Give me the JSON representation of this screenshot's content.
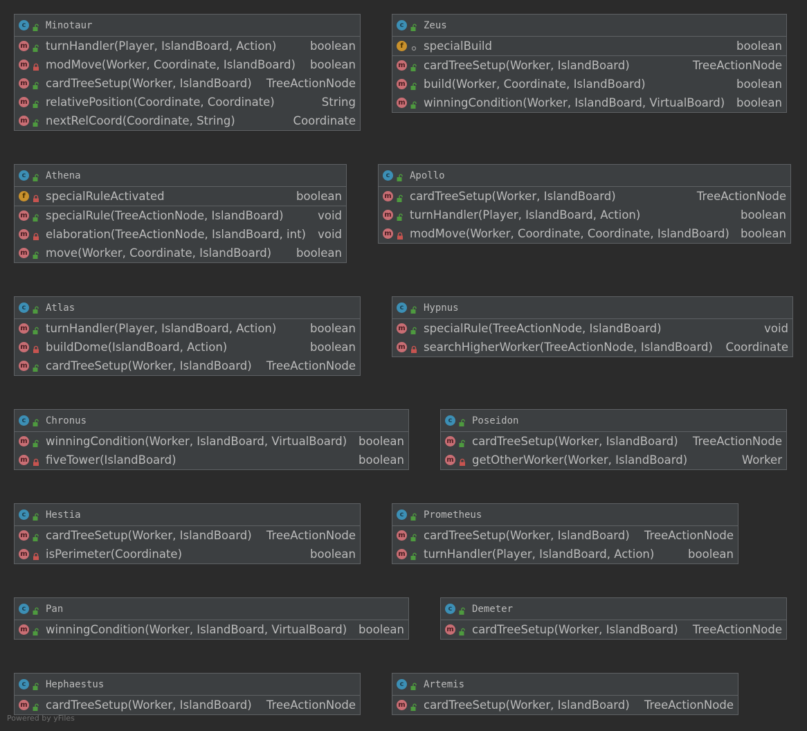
{
  "classes": [
    {
      "name": "Minotaur",
      "badge": "c",
      "rows": [
        {
          "kind": "m",
          "vis": "public",
          "sig": "turnHandler(Player, IslandBoard, Action)",
          "type": "boolean"
        },
        {
          "kind": "m",
          "vis": "private",
          "sig": "modMove(Worker, Coordinate, IslandBoard)",
          "type": "boolean"
        },
        {
          "kind": "m",
          "vis": "public",
          "sig": "cardTreeSetup(Worker, IslandBoard)",
          "type": "TreeActionNode"
        },
        {
          "kind": "m",
          "vis": "public",
          "sig": "relativePosition(Coordinate, Coordinate)",
          "type": "String"
        },
        {
          "kind": "m",
          "vis": "public",
          "sig": "nextRelCoord(Coordinate, String)",
          "type": "Coordinate"
        }
      ]
    },
    {
      "name": "Zeus",
      "badge": "c",
      "rows": [
        {
          "kind": "f",
          "vis": "package",
          "sig": "specialBuild",
          "type": "boolean"
        },
        {
          "kind": "m",
          "vis": "public",
          "sig": "cardTreeSetup(Worker, IslandBoard)",
          "type": "TreeActionNode",
          "sep": true
        },
        {
          "kind": "m",
          "vis": "public",
          "sig": "build(Worker, Coordinate, IslandBoard)",
          "type": "boolean"
        },
        {
          "kind": "m",
          "vis": "public",
          "sig": "winningCondition(Worker, IslandBoard, VirtualBoard)",
          "type": "boolean"
        }
      ]
    },
    {
      "name": "Athena",
      "badge": "c",
      "rows": [
        {
          "kind": "f",
          "vis": "private",
          "sig": "specialRuleActivated",
          "type": "boolean"
        },
        {
          "kind": "m",
          "vis": "public",
          "sig": "specialRule(TreeActionNode, IslandBoard)",
          "type": "void",
          "sep": true
        },
        {
          "kind": "m",
          "vis": "private",
          "sig": "elaboration(TreeActionNode, IslandBoard, int)",
          "type": "void"
        },
        {
          "kind": "m",
          "vis": "public",
          "sig": "move(Worker, Coordinate, IslandBoard)",
          "type": "boolean"
        }
      ]
    },
    {
      "name": "Apollo",
      "badge": "c",
      "rows": [
        {
          "kind": "m",
          "vis": "public",
          "sig": "cardTreeSetup(Worker, IslandBoard)",
          "type": "TreeActionNode"
        },
        {
          "kind": "m",
          "vis": "public",
          "sig": "turnHandler(Player, IslandBoard, Action)",
          "type": "boolean"
        },
        {
          "kind": "m",
          "vis": "private",
          "sig": "modMove(Worker, Coordinate, Coordinate, IslandBoard)",
          "type": "boolean"
        }
      ]
    },
    {
      "name": "Atlas",
      "badge": "c",
      "rows": [
        {
          "kind": "m",
          "vis": "public",
          "sig": "turnHandler(Player, IslandBoard, Action)",
          "type": "boolean"
        },
        {
          "kind": "m",
          "vis": "private",
          "sig": "buildDome(IslandBoard, Action)",
          "type": "boolean"
        },
        {
          "kind": "m",
          "vis": "public",
          "sig": "cardTreeSetup(Worker, IslandBoard)",
          "type": "TreeActionNode"
        }
      ]
    },
    {
      "name": "Hypnus",
      "badge": "c",
      "rows": [
        {
          "kind": "m",
          "vis": "public",
          "sig": "specialRule(TreeActionNode, IslandBoard)",
          "type": "void"
        },
        {
          "kind": "m",
          "vis": "private",
          "sig": "searchHigherWorker(TreeActionNode, IslandBoard)",
          "type": "Coordinate"
        }
      ]
    },
    {
      "name": "Chronus",
      "badge": "c",
      "rows": [
        {
          "kind": "m",
          "vis": "public",
          "sig": "winningCondition(Worker, IslandBoard, VirtualBoard)",
          "type": "boolean"
        },
        {
          "kind": "m",
          "vis": "private",
          "sig": "fiveTower(IslandBoard)",
          "type": "boolean"
        }
      ]
    },
    {
      "name": "Poseidon",
      "badge": "c",
      "rows": [
        {
          "kind": "m",
          "vis": "public",
          "sig": "cardTreeSetup(Worker, IslandBoard)",
          "type": "TreeActionNode"
        },
        {
          "kind": "m",
          "vis": "private",
          "sig": "getOtherWorker(Worker, IslandBoard)",
          "type": "Worker"
        }
      ]
    },
    {
      "name": "Hestia",
      "badge": "c",
      "rows": [
        {
          "kind": "m",
          "vis": "public",
          "sig": "cardTreeSetup(Worker, IslandBoard)",
          "type": "TreeActionNode"
        },
        {
          "kind": "m",
          "vis": "private",
          "sig": "isPerimeter(Coordinate)",
          "type": "boolean"
        }
      ]
    },
    {
      "name": "Prometheus",
      "badge": "c",
      "rows": [
        {
          "kind": "m",
          "vis": "public",
          "sig": "cardTreeSetup(Worker, IslandBoard)",
          "type": "TreeActionNode"
        },
        {
          "kind": "m",
          "vis": "public",
          "sig": "turnHandler(Player, IslandBoard, Action)",
          "type": "boolean"
        }
      ]
    },
    {
      "name": "Pan",
      "badge": "c",
      "rows": [
        {
          "kind": "m",
          "vis": "public",
          "sig": "winningCondition(Worker, IslandBoard, VirtualBoard)",
          "type": "boolean"
        }
      ]
    },
    {
      "name": "Demeter",
      "badge": "c",
      "rows": [
        {
          "kind": "m",
          "vis": "public",
          "sig": "cardTreeSetup(Worker, IslandBoard)",
          "type": "TreeActionNode"
        }
      ]
    },
    {
      "name": "Hephaestus",
      "badge": "c",
      "rows": [
        {
          "kind": "m",
          "vis": "public",
          "sig": "cardTreeSetup(Worker, IslandBoard)",
          "type": "TreeActionNode"
        }
      ]
    },
    {
      "name": "Artemis",
      "badge": "c",
      "rows": [
        {
          "kind": "m",
          "vis": "public",
          "sig": "cardTreeSetup(Worker, IslandBoard)",
          "type": "TreeActionNode"
        }
      ]
    }
  ],
  "footer": "Powered by yFiles",
  "colors": {
    "background": "#2b2b2b",
    "box": "#3c3f41",
    "border": "#5e6164",
    "text": "#bbbbbb",
    "class_badge": "#3c8fb5",
    "method_badge": "#c96e74",
    "field_badge": "#c9912c",
    "public": "#4e9a3f",
    "private": "#c75450"
  }
}
